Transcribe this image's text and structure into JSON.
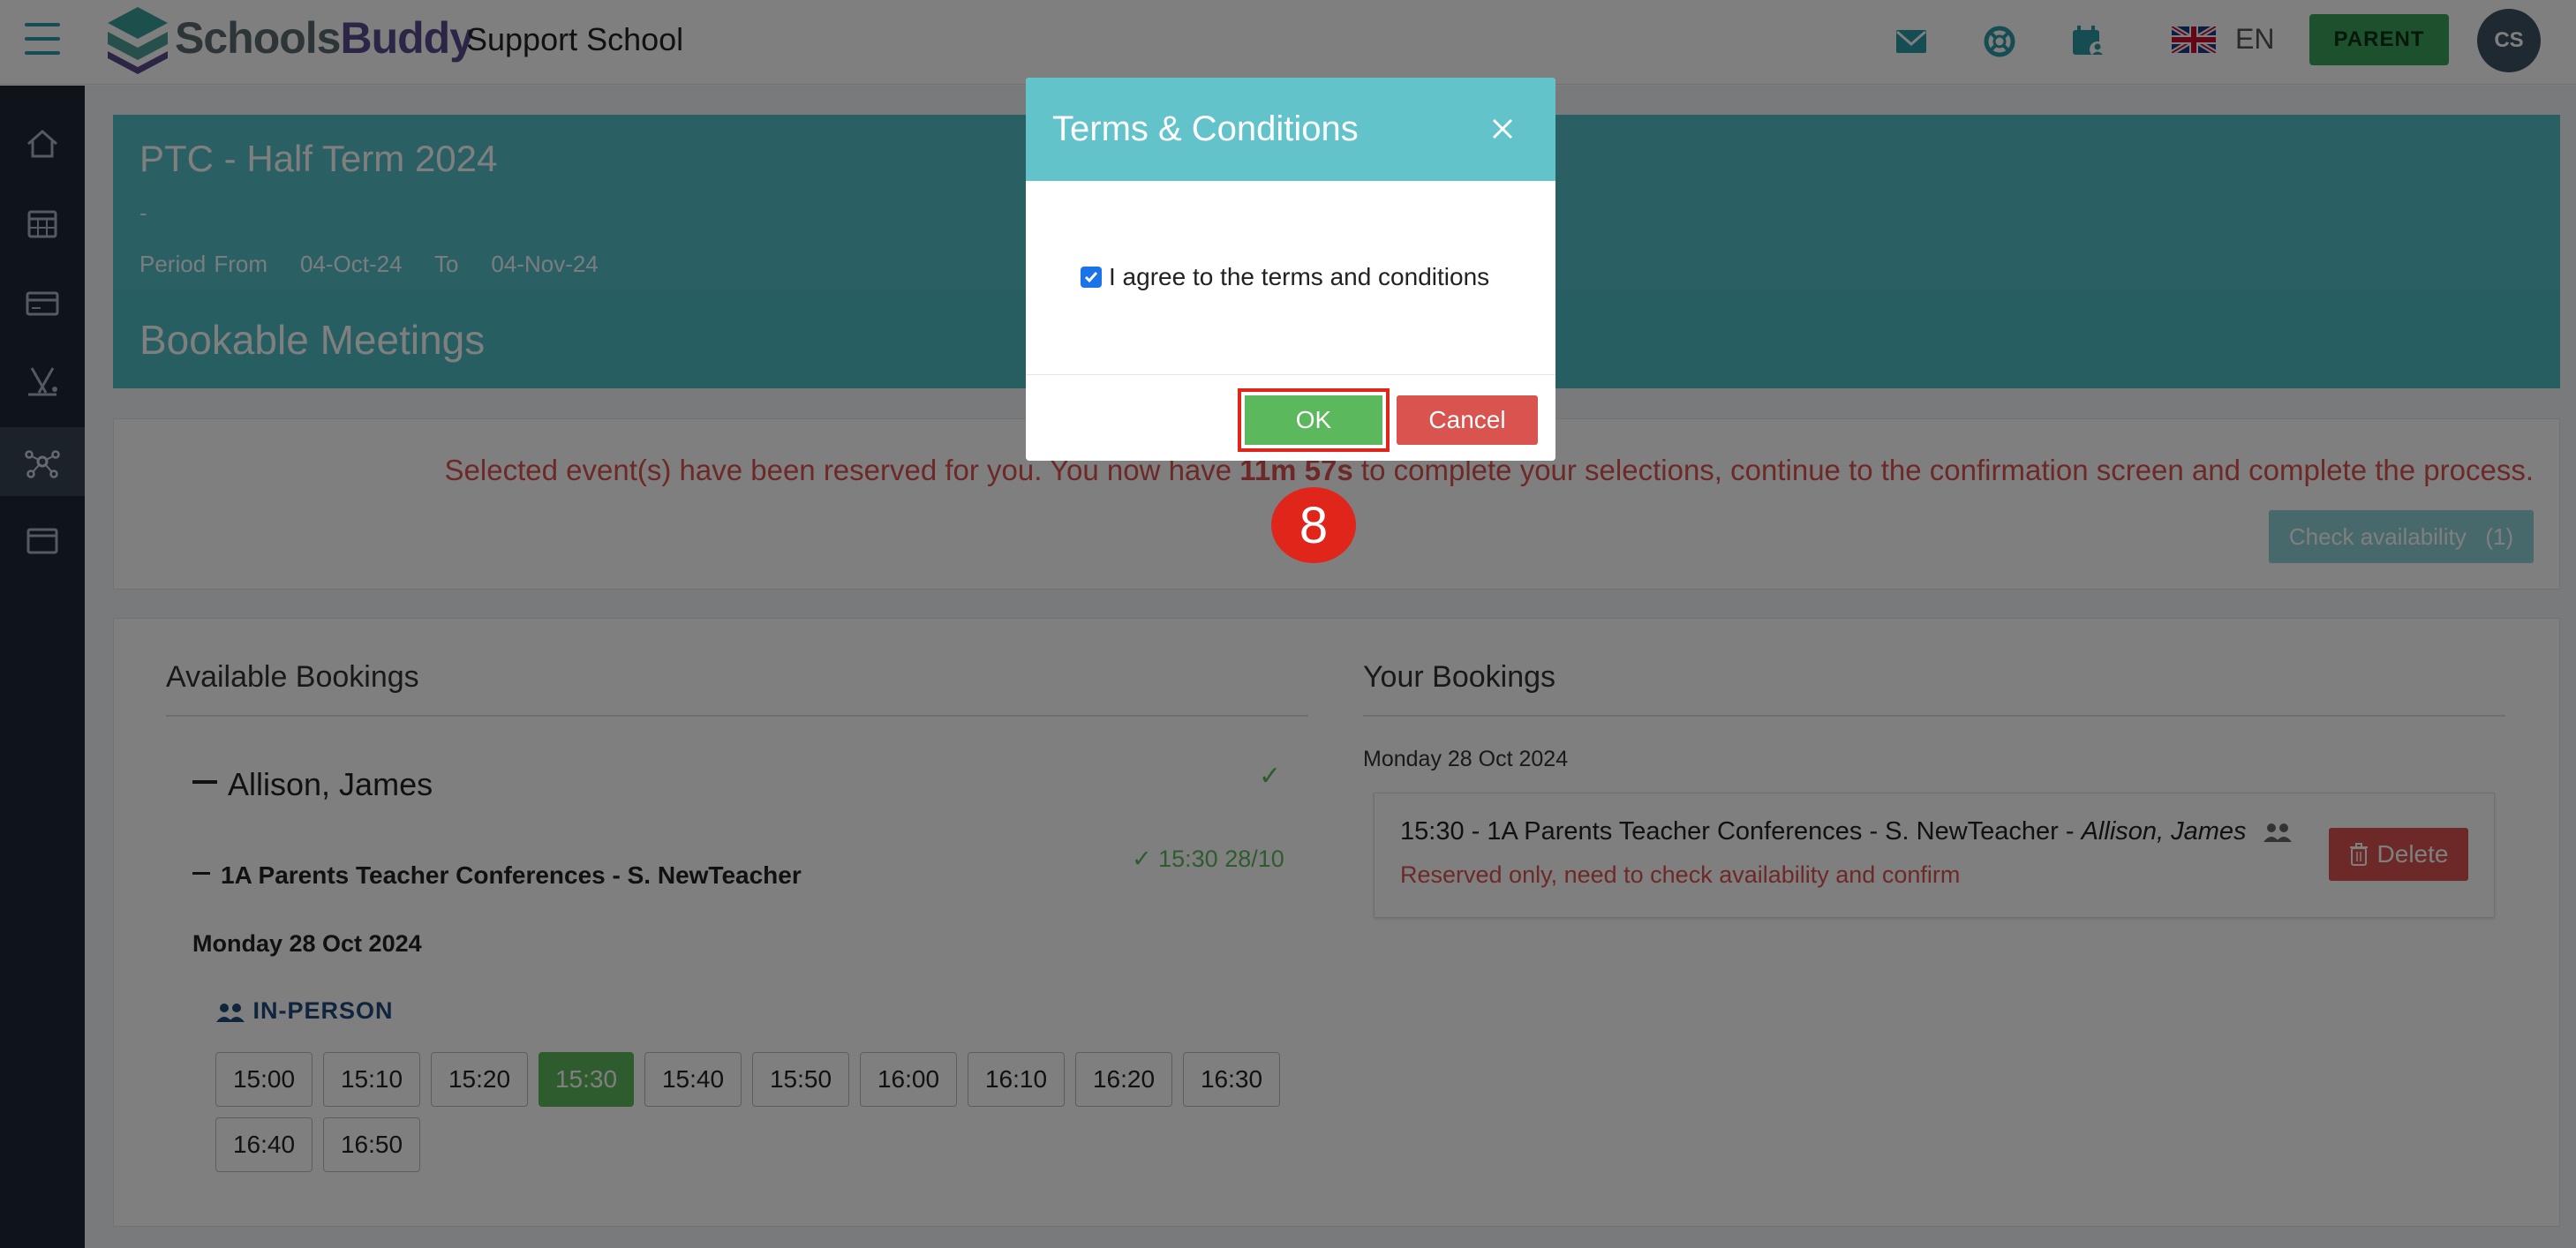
{
  "header": {
    "logo_text_1": "Schools",
    "logo_text_2": "Buddy",
    "school_name": "Support School",
    "language": "EN",
    "role_button": "PARENT",
    "avatar_initials": "CS",
    "icons": [
      "envelope-icon",
      "lifebuoy-icon",
      "calendar-user-icon"
    ]
  },
  "sidebar": {
    "items": [
      "home-icon",
      "calendar-icon",
      "card-icon",
      "activities-icon",
      "network-icon",
      "window-icon"
    ],
    "active": "network-icon"
  },
  "event": {
    "title": "PTC - Half Term 2024",
    "dash": "-",
    "period_from_label": "Period From",
    "period_from": "04-Oct-24",
    "to_label": "To",
    "period_to": "04-Nov-24",
    "section_title": "Bookable Meetings"
  },
  "notice": {
    "text_before": "Selected event(s) have been reserved for you. You now have ",
    "time_left": "11m 57s",
    "text_after": " to complete your selections, continue to the confirmation screen and complete the process.",
    "check_button": "Check availability   (1)"
  },
  "available": {
    "title": "Available Bookings",
    "person": "Allison, James",
    "conference": "1A Parents Teacher Conferences - S. NewTeacher",
    "selected_time": "15:30 28/10",
    "day": "Monday 28 Oct 2024",
    "mode": "IN-PERSON",
    "slots_row1": [
      "15:00",
      "15:10",
      "15:20",
      "15:30",
      "15:40",
      "15:50",
      "16:00",
      "16:10",
      "16:20",
      "16:30"
    ],
    "slots_row2": [
      "16:40",
      "16:50"
    ],
    "selected_slot": "15:30"
  },
  "your_bookings": {
    "title": "Your Bookings",
    "day": "Monday 28 Oct 2024",
    "booking_text": "15:30 - 1A Parents Teacher Conferences - S. NewTeacher - ",
    "booking_person": "Allison, James",
    "status": "Reserved only, need to check availability and confirm",
    "delete_button": "Delete"
  },
  "modal": {
    "title": "Terms & Conditions",
    "agree_label": "I agree to the terms and conditions",
    "agree_checked": true,
    "ok_button": "OK",
    "cancel_button": "Cancel"
  },
  "annotation": {
    "step_number": "8"
  },
  "colors": {
    "teal": "#55c1c9",
    "green": "#5cb85c",
    "red": "#d9534f",
    "sidebar": "#1f2937",
    "highlight": "#e0251b"
  }
}
